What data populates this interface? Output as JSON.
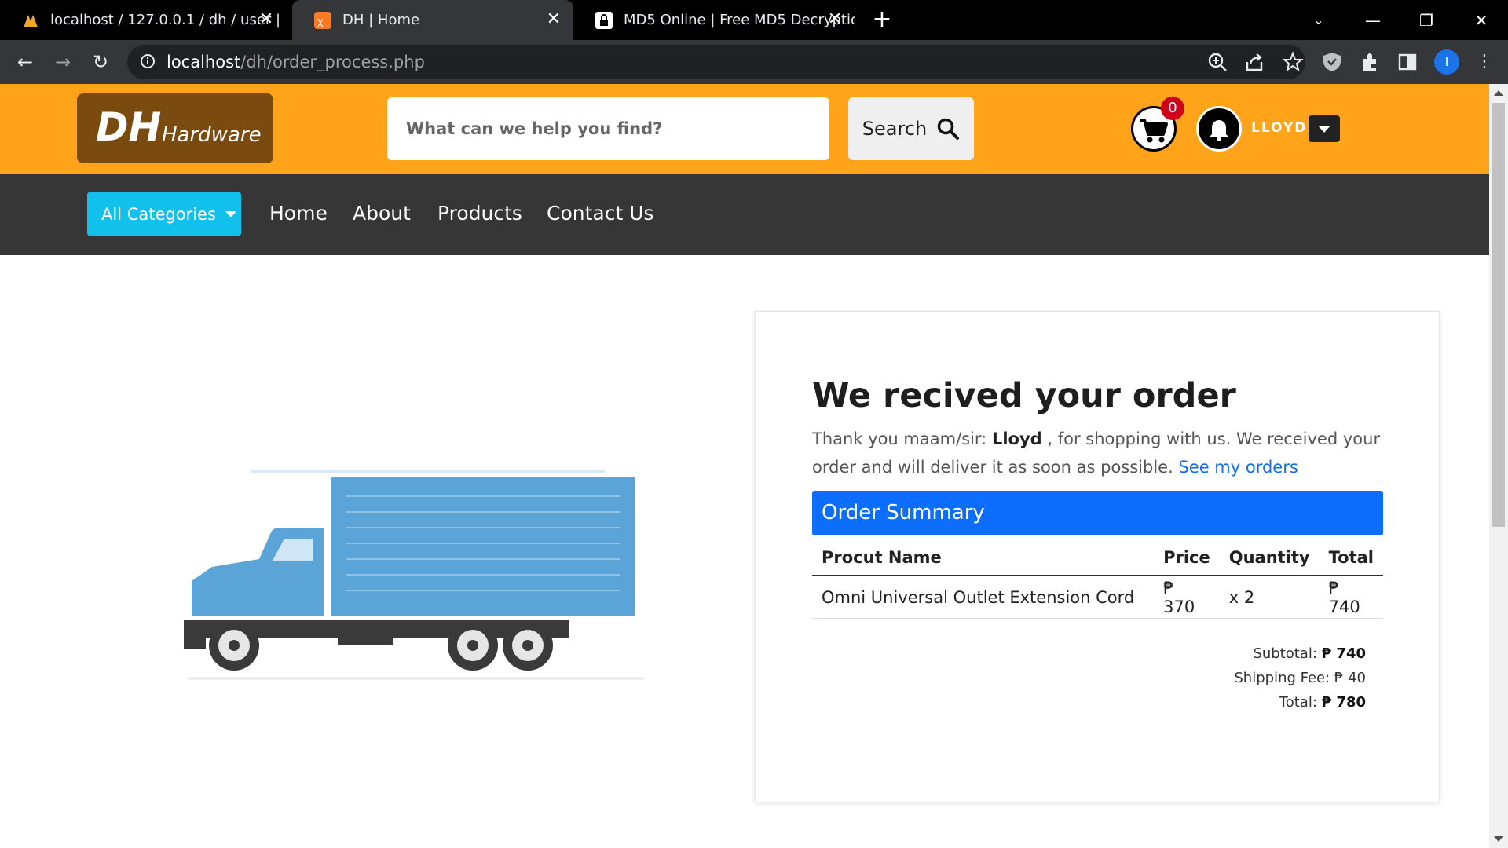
{
  "browser": {
    "tabs": [
      {
        "title": "localhost / 127.0.0.1 / dh / user |",
        "active": false
      },
      {
        "title": "DH | Home",
        "active": true
      },
      {
        "title": "MD5 Online | Free MD5 Decryptio",
        "active": false
      }
    ],
    "url_host": "localhost",
    "url_path": "/dh/order_process.php",
    "profile_initial": "I"
  },
  "header": {
    "logo_main": "DH",
    "logo_sub": "Hardware",
    "search_placeholder": "What can we help you find?",
    "search_label": "Search",
    "cart_count": "0",
    "user_name": "LLOYD"
  },
  "nav": {
    "categories_label": "All Categories",
    "links": [
      "Home",
      "About",
      "Products",
      "Contact Us"
    ]
  },
  "order": {
    "title": "We recived your order",
    "thank_prefix": "Thank you maam/sir: ",
    "customer": "Lloyd",
    "thank_suffix": " , for shopping with us. We received your order and will deliver it as soon as possible. ",
    "orders_link": "See my orders",
    "summary_title": "Order Summary",
    "columns": [
      "Procut Name",
      "Price",
      "Quantity",
      "Total"
    ],
    "rows": [
      {
        "name": "Omni Universal Outlet Extension Cord",
        "price": "₱ 370",
        "qty": "x 2",
        "total": "₱ 740"
      }
    ],
    "subtotal_label": "Subtotal: ",
    "subtotal": "₱ 740",
    "shipping_label": "Shipping Fee: ",
    "shipping": "₱ 40",
    "total_label": "Total: ",
    "total": "₱ 780"
  },
  "colors": {
    "header_bg": "#ffa31a",
    "nav_bg": "#363636",
    "accent_blue": "#0d6efd",
    "categories_bg": "#12c0ec"
  }
}
